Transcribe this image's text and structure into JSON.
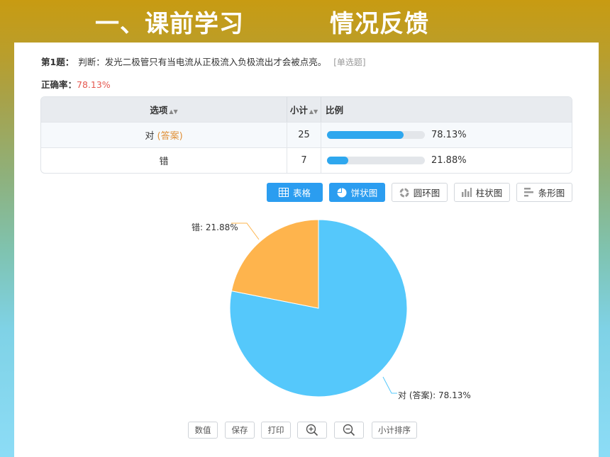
{
  "slide": {
    "title_part1": "一、课前学习",
    "title_part2": "情况反馈"
  },
  "question": {
    "number_label": "第1题：",
    "text": "判断：发光二极管只有当电流从正极流入负极流出才会被点亮。",
    "type_label": "[单选题]"
  },
  "accuracy": {
    "label": "正确率：",
    "value": "78.13%"
  },
  "table": {
    "headers": {
      "option": "选项",
      "count": "小计",
      "ratio": "比例"
    },
    "sort_icon": "sort-icon",
    "rows": [
      {
        "option": "对",
        "answer_tag": "(答案)",
        "count": "25",
        "ratio": 0.7813,
        "ratio_text": "78.13%"
      },
      {
        "option": "错",
        "answer_tag": "",
        "count": "7",
        "ratio": 0.2188,
        "ratio_text": "21.88%"
      }
    ]
  },
  "view_buttons": [
    {
      "label": "表格",
      "icon": "table-icon",
      "active": true
    },
    {
      "label": "饼状图",
      "icon": "pie-chart-icon",
      "active": true
    },
    {
      "label": "圆环图",
      "icon": "donut-chart-icon",
      "active": false
    },
    {
      "label": "柱状图",
      "icon": "bar-chart-icon",
      "active": false
    },
    {
      "label": "条形图",
      "icon": "horizontal-bar-chart-icon",
      "active": false
    }
  ],
  "chart_data": {
    "type": "pie",
    "title": "",
    "slices": [
      {
        "label": "对 (答案)",
        "value": 78.13,
        "display": "对 (答案): 78.13%",
        "color": "#55c8fb"
      },
      {
        "label": "错",
        "value": 21.88,
        "display": "错: 21.88%",
        "color": "#feb44d"
      }
    ],
    "legend": "none"
  },
  "bottom_buttons": [
    {
      "label": "数值"
    },
    {
      "label": "保存"
    },
    {
      "label": "打印"
    },
    {
      "label": "",
      "icon": "zoom-in-icon"
    },
    {
      "label": "",
      "icon": "zoom-out-icon"
    },
    {
      "label": "小计排序"
    }
  ],
  "colors": {
    "accent": "#2b9df0",
    "correct_rate": "#e5574f",
    "answer_tag": "#e0913a"
  }
}
